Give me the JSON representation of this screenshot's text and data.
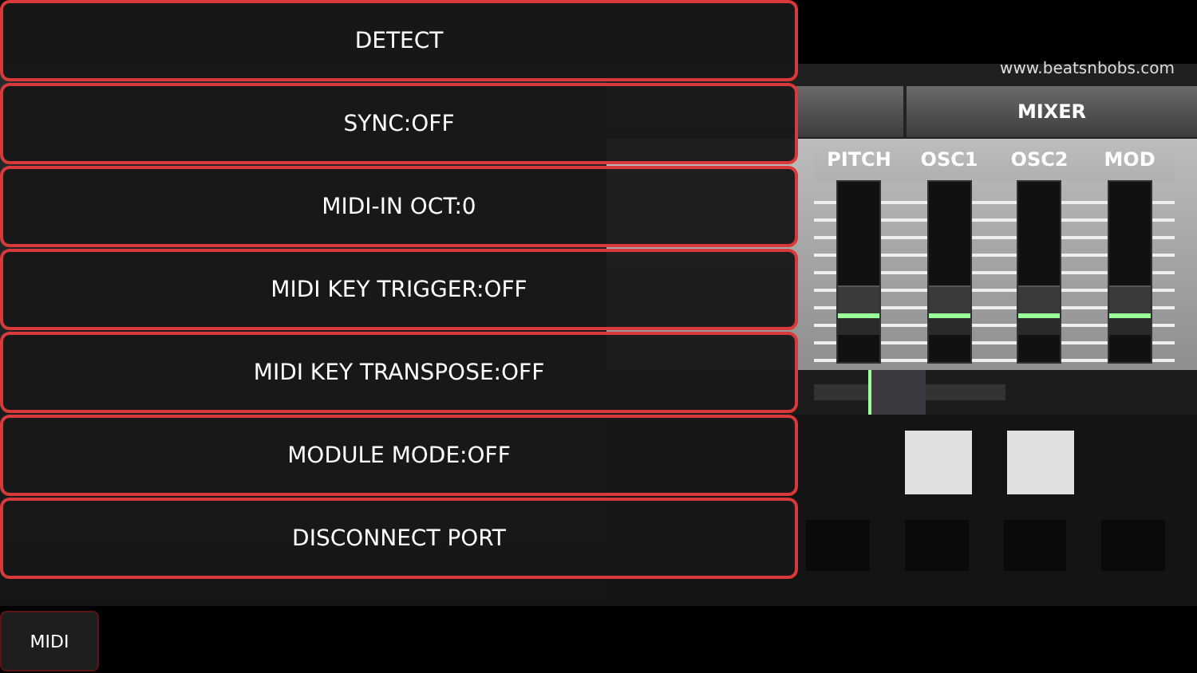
{
  "menu": {
    "items": [
      {
        "label": "DETECT"
      },
      {
        "label": "SYNC:OFF"
      },
      {
        "label": "MIDI-IN OCT:0"
      },
      {
        "label": "MIDI KEY TRIGGER:OFF"
      },
      {
        "label": "MIDI KEY TRANSPOSE:OFF"
      },
      {
        "label": "MODULE MODE:OFF"
      },
      {
        "label": "DISCONNECT PORT"
      }
    ]
  },
  "synth": {
    "url": "www.beatsnbobs.com",
    "section": "MIXER",
    "faders": [
      {
        "label": "PITCH",
        "level": 0.2
      },
      {
        "label": "OSC1",
        "level": 0.2
      },
      {
        "label": "OSC2",
        "level": 0.2
      },
      {
        "label": "MOD",
        "level": 0.2
      }
    ],
    "tempo": {
      "level": 0.4
    },
    "pads": [
      {
        "on": true
      },
      {
        "on": true
      }
    ],
    "steps": [
      {
        "on": false
      },
      {
        "on": false
      },
      {
        "on": false
      },
      {
        "on": false
      }
    ]
  },
  "midi_button": "MIDI"
}
